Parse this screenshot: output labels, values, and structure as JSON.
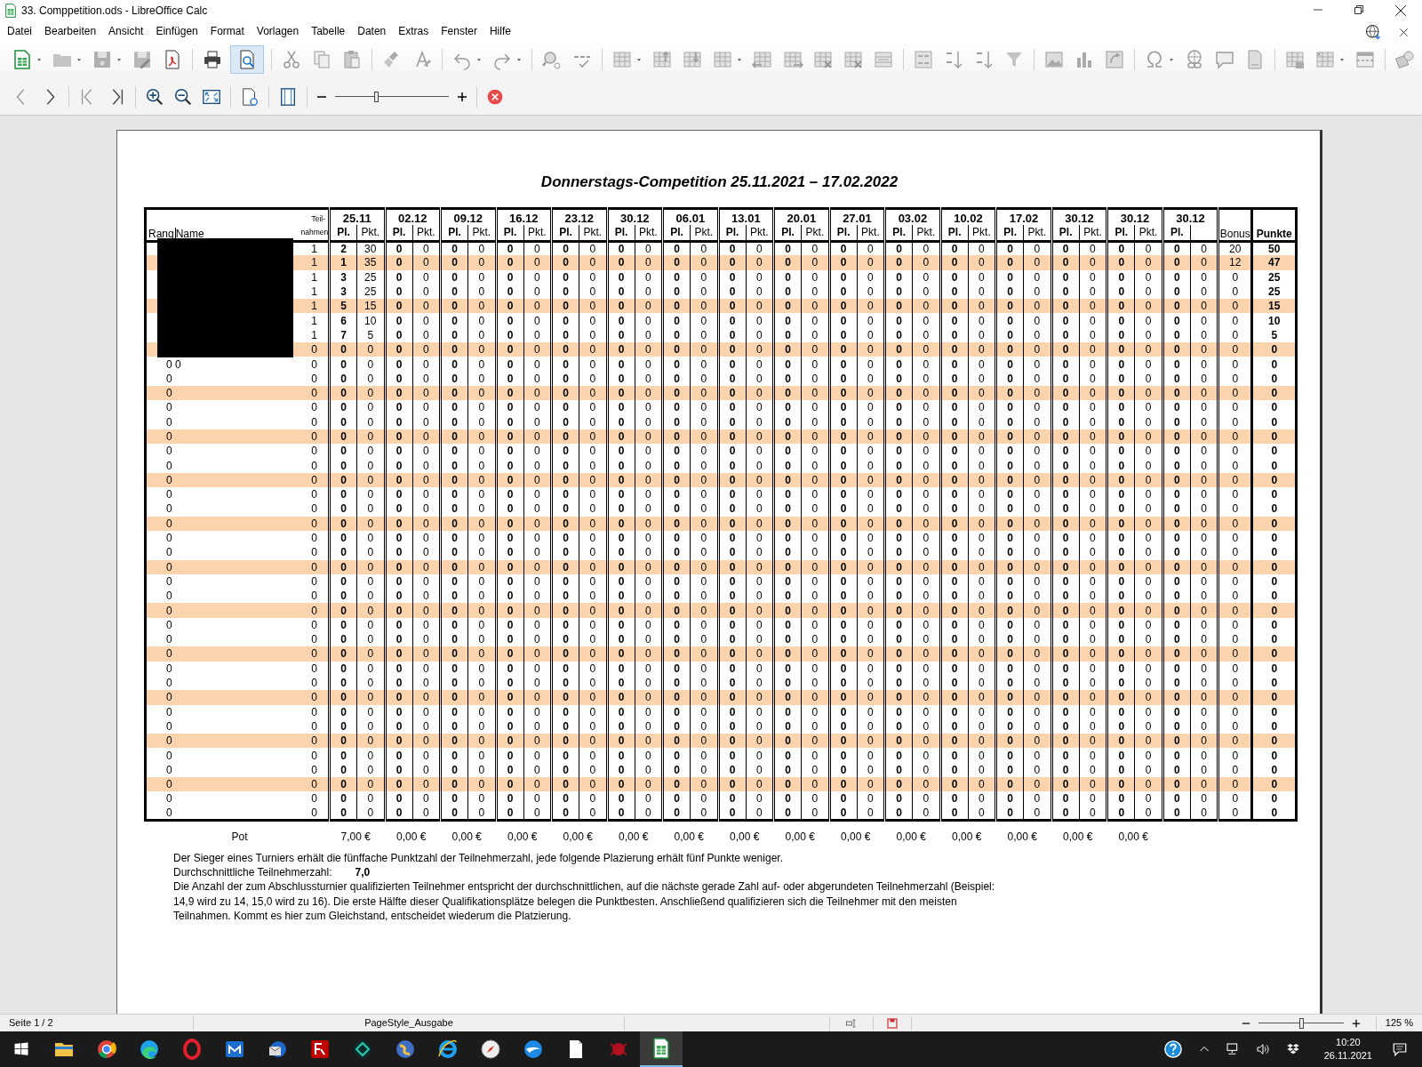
{
  "window": {
    "title": "33. Comppetition.ods - LibreOffice Calc"
  },
  "menu": [
    "Datei",
    "Bearbeiten",
    "Ansicht",
    "Einfügen",
    "Format",
    "Vorlagen",
    "Tabelle",
    "Daten",
    "Extras",
    "Fenster",
    "Hilfe"
  ],
  "toolbar": {
    "print_preview": {
      "selected": true
    }
  },
  "preview_toolbar": {
    "zoom_slider": {
      "level": 0.36
    }
  },
  "document": {
    "title": "Donnerstags-Competition 25.11.2021 – 17.02.2022",
    "header": {
      "rang": "Rang",
      "name": "Name",
      "teilnahmen_top": "Teil-",
      "teilnahmen_bottom": "nahmen",
      "bonus": "Bonus",
      "punkte": "Punkte"
    },
    "tournaments": [
      {
        "date": "25.11",
        "pl": "Pl.",
        "pkt": "Pkt."
      },
      {
        "date": "02.12",
        "pl": "Pl.",
        "pkt": "Pkt."
      },
      {
        "date": "09.12",
        "pl": "Pl.",
        "pkt": "Pkt."
      },
      {
        "date": "16.12",
        "pl": "Pl.",
        "pkt": "Pkt."
      },
      {
        "date": "23.12",
        "pl": "Pl.",
        "pkt": "Pkt."
      },
      {
        "date": "30.12",
        "pl": "Pl.",
        "pkt": "Pkt."
      },
      {
        "date": "06.01",
        "pl": "Pl.",
        "pkt": "Pkt."
      },
      {
        "date": "13.01",
        "pl": "Pl.",
        "pkt": "Pkt."
      },
      {
        "date": "20.01",
        "pl": "Pl.",
        "pkt": "Pkt."
      },
      {
        "date": "27.01",
        "pl": "Pl.",
        "pkt": "Pkt."
      },
      {
        "date": "03.02",
        "pl": "Pl.",
        "pkt": "Pkt."
      },
      {
        "date": "10.02",
        "pl": "Pl.",
        "pkt": "Pkt."
      },
      {
        "date": "17.02",
        "pl": "Pl.",
        "pkt": "Pkt."
      },
      {
        "date": "30.12",
        "pl": "Pl.",
        "pkt": "Pkt."
      },
      {
        "date": "30.12",
        "pl": "Pl.",
        "pkt": "Pkt."
      },
      {
        "date": "30.12",
        "pl": "Pl."
      }
    ],
    "rows": [
      {
        "redacted": true,
        "teilnahmen": "1",
        "results": [
          "2",
          "30",
          "0",
          "0",
          "0",
          "0",
          "0",
          "0",
          "0",
          "0",
          "0",
          "0",
          "0",
          "0",
          "0",
          "0",
          "0",
          "0",
          "0",
          "0",
          "0",
          "0",
          "0",
          "0",
          "0",
          "0",
          "0",
          "0",
          "0",
          "0",
          "0",
          "0"
        ],
        "bonus": "20",
        "punkte": "50",
        "shaded": false
      },
      {
        "redacted": true,
        "teilnahmen": "1",
        "results": [
          "1",
          "35",
          "0",
          "0",
          "0",
          "0",
          "0",
          "0",
          "0",
          "0",
          "0",
          "0",
          "0",
          "0",
          "0",
          "0",
          "0",
          "0",
          "0",
          "0",
          "0",
          "0",
          "0",
          "0",
          "0",
          "0",
          "0",
          "0",
          "0",
          "0",
          "0",
          "0"
        ],
        "bonus": "12",
        "punkte": "47",
        "shaded": true
      },
      {
        "redacted": true,
        "teilnahmen": "1",
        "results": [
          "3",
          "25",
          "0",
          "0",
          "0",
          "0",
          "0",
          "0",
          "0",
          "0",
          "0",
          "0",
          "0",
          "0",
          "0",
          "0",
          "0",
          "0",
          "0",
          "0",
          "0",
          "0",
          "0",
          "0",
          "0",
          "0",
          "0",
          "0",
          "0",
          "0",
          "0",
          "0"
        ],
        "bonus": "0",
        "punkte": "25",
        "shaded": false
      },
      {
        "redacted": true,
        "teilnahmen": "1",
        "results": [
          "3",
          "25",
          "0",
          "0",
          "0",
          "0",
          "0",
          "0",
          "0",
          "0",
          "0",
          "0",
          "0",
          "0",
          "0",
          "0",
          "0",
          "0",
          "0",
          "0",
          "0",
          "0",
          "0",
          "0",
          "0",
          "0",
          "0",
          "0",
          "0",
          "0",
          "0",
          "0"
        ],
        "bonus": "0",
        "punkte": "25",
        "shaded": false
      },
      {
        "redacted": true,
        "teilnahmen": "1",
        "results": [
          "5",
          "15",
          "0",
          "0",
          "0",
          "0",
          "0",
          "0",
          "0",
          "0",
          "0",
          "0",
          "0",
          "0",
          "0",
          "0",
          "0",
          "0",
          "0",
          "0",
          "0",
          "0",
          "0",
          "0",
          "0",
          "0",
          "0",
          "0",
          "0",
          "0",
          "0",
          "0"
        ],
        "bonus": "0",
        "punkte": "15",
        "shaded": true
      },
      {
        "redacted": true,
        "teilnahmen": "1",
        "results": [
          "6",
          "10",
          "0",
          "0",
          "0",
          "0",
          "0",
          "0",
          "0",
          "0",
          "0",
          "0",
          "0",
          "0",
          "0",
          "0",
          "0",
          "0",
          "0",
          "0",
          "0",
          "0",
          "0",
          "0",
          "0",
          "0",
          "0",
          "0",
          "0",
          "0",
          "0",
          "0"
        ],
        "bonus": "0",
        "punkte": "10",
        "shaded": false
      },
      {
        "redacted": true,
        "teilnahmen": "1",
        "results": [
          "7",
          "5",
          "0",
          "0",
          "0",
          "0",
          "0",
          "0",
          "0",
          "0",
          "0",
          "0",
          "0",
          "0",
          "0",
          "0",
          "0",
          "0",
          "0",
          "0",
          "0",
          "0",
          "0",
          "0",
          "0",
          "0",
          "0",
          "0",
          "0",
          "0",
          "0",
          "0"
        ],
        "bonus": "0",
        "punkte": "5",
        "shaded": false
      },
      {
        "redacted": true,
        "teilnahmen": "0",
        "results": [
          "0",
          "0",
          "0",
          "0",
          "0",
          "0",
          "0",
          "0",
          "0",
          "0",
          "0",
          "0",
          "0",
          "0",
          "0",
          "0",
          "0",
          "0",
          "0",
          "0",
          "0",
          "0",
          "0",
          "0",
          "0",
          "0",
          "0",
          "0",
          "0",
          "0",
          "0",
          "0"
        ],
        "bonus": "0",
        "punkte": "0",
        "shaded": true
      },
      {
        "rang": "0",
        "name": "0",
        "teilnahmen": "0",
        "results": [
          "0",
          "0",
          "0",
          "0",
          "0",
          "0",
          "0",
          "0",
          "0",
          "0",
          "0",
          "0",
          "0",
          "0",
          "0",
          "0",
          "0",
          "0",
          "0",
          "0",
          "0",
          "0",
          "0",
          "0",
          "0",
          "0",
          "0",
          "0",
          "0",
          "0",
          "0",
          "0"
        ],
        "bonus": "0",
        "punkte": "0",
        "shaded": false
      },
      {
        "rang": "0",
        "teilnahmen": "0",
        "results": [
          "0",
          "0",
          "0",
          "0",
          "0",
          "0",
          "0",
          "0",
          "0",
          "0",
          "0",
          "0",
          "0",
          "0",
          "0",
          "0",
          "0",
          "0",
          "0",
          "0",
          "0",
          "0",
          "0",
          "0",
          "0",
          "0",
          "0",
          "0",
          "0",
          "0",
          "0",
          "0"
        ],
        "bonus": "0",
        "punkte": "0",
        "shaded": false
      },
      {
        "rang": "0",
        "teilnahmen": "0",
        "results": [
          "0",
          "0",
          "0",
          "0",
          "0",
          "0",
          "0",
          "0",
          "0",
          "0",
          "0",
          "0",
          "0",
          "0",
          "0",
          "0",
          "0",
          "0",
          "0",
          "0",
          "0",
          "0",
          "0",
          "0",
          "0",
          "0",
          "0",
          "0",
          "0",
          "0",
          "0",
          "0"
        ],
        "bonus": "0",
        "punkte": "0",
        "shaded": true
      },
      {
        "rang": "0",
        "teilnahmen": "0",
        "results": [
          "0",
          "0",
          "0",
          "0",
          "0",
          "0",
          "0",
          "0",
          "0",
          "0",
          "0",
          "0",
          "0",
          "0",
          "0",
          "0",
          "0",
          "0",
          "0",
          "0",
          "0",
          "0",
          "0",
          "0",
          "0",
          "0",
          "0",
          "0",
          "0",
          "0",
          "0",
          "0"
        ],
        "bonus": "0",
        "punkte": "0",
        "shaded": false
      },
      {
        "rang": "0",
        "teilnahmen": "0",
        "results": [
          "0",
          "0",
          "0",
          "0",
          "0",
          "0",
          "0",
          "0",
          "0",
          "0",
          "0",
          "0",
          "0",
          "0",
          "0",
          "0",
          "0",
          "0",
          "0",
          "0",
          "0",
          "0",
          "0",
          "0",
          "0",
          "0",
          "0",
          "0",
          "0",
          "0",
          "0",
          "0"
        ],
        "bonus": "0",
        "punkte": "0",
        "shaded": false
      },
      {
        "rang": "0",
        "teilnahmen": "0",
        "results": [
          "0",
          "0",
          "0",
          "0",
          "0",
          "0",
          "0",
          "0",
          "0",
          "0",
          "0",
          "0",
          "0",
          "0",
          "0",
          "0",
          "0",
          "0",
          "0",
          "0",
          "0",
          "0",
          "0",
          "0",
          "0",
          "0",
          "0",
          "0",
          "0",
          "0",
          "0",
          "0"
        ],
        "bonus": "0",
        "punkte": "0",
        "shaded": true
      },
      {
        "rang": "0",
        "teilnahmen": "0",
        "results": [
          "0",
          "0",
          "0",
          "0",
          "0",
          "0",
          "0",
          "0",
          "0",
          "0",
          "0",
          "0",
          "0",
          "0",
          "0",
          "0",
          "0",
          "0",
          "0",
          "0",
          "0",
          "0",
          "0",
          "0",
          "0",
          "0",
          "0",
          "0",
          "0",
          "0",
          "0",
          "0"
        ],
        "bonus": "0",
        "punkte": "0",
        "shaded": false
      },
      {
        "rang": "0",
        "teilnahmen": "0",
        "results": [
          "0",
          "0",
          "0",
          "0",
          "0",
          "0",
          "0",
          "0",
          "0",
          "0",
          "0",
          "0",
          "0",
          "0",
          "0",
          "0",
          "0",
          "0",
          "0",
          "0",
          "0",
          "0",
          "0",
          "0",
          "0",
          "0",
          "0",
          "0",
          "0",
          "0",
          "0",
          "0"
        ],
        "bonus": "0",
        "punkte": "0",
        "shaded": false
      },
      {
        "rang": "0",
        "teilnahmen": "0",
        "results": [
          "0",
          "0",
          "0",
          "0",
          "0",
          "0",
          "0",
          "0",
          "0",
          "0",
          "0",
          "0",
          "0",
          "0",
          "0",
          "0",
          "0",
          "0",
          "0",
          "0",
          "0",
          "0",
          "0",
          "0",
          "0",
          "0",
          "0",
          "0",
          "0",
          "0",
          "0",
          "0"
        ],
        "bonus": "0",
        "punkte": "0",
        "shaded": true
      },
      {
        "rang": "0",
        "teilnahmen": "0",
        "results": [
          "0",
          "0",
          "0",
          "0",
          "0",
          "0",
          "0",
          "0",
          "0",
          "0",
          "0",
          "0",
          "0",
          "0",
          "0",
          "0",
          "0",
          "0",
          "0",
          "0",
          "0",
          "0",
          "0",
          "0",
          "0",
          "0",
          "0",
          "0",
          "0",
          "0",
          "0",
          "0"
        ],
        "bonus": "0",
        "punkte": "0",
        "shaded": false
      },
      {
        "rang": "0",
        "teilnahmen": "0",
        "results": [
          "0",
          "0",
          "0",
          "0",
          "0",
          "0",
          "0",
          "0",
          "0",
          "0",
          "0",
          "0",
          "0",
          "0",
          "0",
          "0",
          "0",
          "0",
          "0",
          "0",
          "0",
          "0",
          "0",
          "0",
          "0",
          "0",
          "0",
          "0",
          "0",
          "0",
          "0",
          "0"
        ],
        "bonus": "0",
        "punkte": "0",
        "shaded": false
      },
      {
        "rang": "0",
        "teilnahmen": "0",
        "results": [
          "0",
          "0",
          "0",
          "0",
          "0",
          "0",
          "0",
          "0",
          "0",
          "0",
          "0",
          "0",
          "0",
          "0",
          "0",
          "0",
          "0",
          "0",
          "0",
          "0",
          "0",
          "0",
          "0",
          "0",
          "0",
          "0",
          "0",
          "0",
          "0",
          "0",
          "0",
          "0"
        ],
        "bonus": "0",
        "punkte": "0",
        "shaded": true
      },
      {
        "rang": "0",
        "teilnahmen": "0",
        "results": [
          "0",
          "0",
          "0",
          "0",
          "0",
          "0",
          "0",
          "0",
          "0",
          "0",
          "0",
          "0",
          "0",
          "0",
          "0",
          "0",
          "0",
          "0",
          "0",
          "0",
          "0",
          "0",
          "0",
          "0",
          "0",
          "0",
          "0",
          "0",
          "0",
          "0",
          "0",
          "0"
        ],
        "bonus": "0",
        "punkte": "0",
        "shaded": false
      },
      {
        "rang": "0",
        "teilnahmen": "0",
        "results": [
          "0",
          "0",
          "0",
          "0",
          "0",
          "0",
          "0",
          "0",
          "0",
          "0",
          "0",
          "0",
          "0",
          "0",
          "0",
          "0",
          "0",
          "0",
          "0",
          "0",
          "0",
          "0",
          "0",
          "0",
          "0",
          "0",
          "0",
          "0",
          "0",
          "0",
          "0",
          "0"
        ],
        "bonus": "0",
        "punkte": "0",
        "shaded": false
      },
      {
        "rang": "0",
        "teilnahmen": "0",
        "results": [
          "0",
          "0",
          "0",
          "0",
          "0",
          "0",
          "0",
          "0",
          "0",
          "0",
          "0",
          "0",
          "0",
          "0",
          "0",
          "0",
          "0",
          "0",
          "0",
          "0",
          "0",
          "0",
          "0",
          "0",
          "0",
          "0",
          "0",
          "0",
          "0",
          "0",
          "0",
          "0"
        ],
        "bonus": "0",
        "punkte": "0",
        "shaded": true
      },
      {
        "rang": "0",
        "teilnahmen": "0",
        "results": [
          "0",
          "0",
          "0",
          "0",
          "0",
          "0",
          "0",
          "0",
          "0",
          "0",
          "0",
          "0",
          "0",
          "0",
          "0",
          "0",
          "0",
          "0",
          "0",
          "0",
          "0",
          "0",
          "0",
          "0",
          "0",
          "0",
          "0",
          "0",
          "0",
          "0",
          "0",
          "0"
        ],
        "bonus": "0",
        "punkte": "0",
        "shaded": false
      },
      {
        "rang": "0",
        "teilnahmen": "0",
        "results": [
          "0",
          "0",
          "0",
          "0",
          "0",
          "0",
          "0",
          "0",
          "0",
          "0",
          "0",
          "0",
          "0",
          "0",
          "0",
          "0",
          "0",
          "0",
          "0",
          "0",
          "0",
          "0",
          "0",
          "0",
          "0",
          "0",
          "0",
          "0",
          "0",
          "0",
          "0",
          "0"
        ],
        "bonus": "0",
        "punkte": "0",
        "shaded": false
      },
      {
        "rang": "0",
        "teilnahmen": "0",
        "results": [
          "0",
          "0",
          "0",
          "0",
          "0",
          "0",
          "0",
          "0",
          "0",
          "0",
          "0",
          "0",
          "0",
          "0",
          "0",
          "0",
          "0",
          "0",
          "0",
          "0",
          "0",
          "0",
          "0",
          "0",
          "0",
          "0",
          "0",
          "0",
          "0",
          "0",
          "0",
          "0"
        ],
        "bonus": "0",
        "punkte": "0",
        "shaded": true
      },
      {
        "rang": "0",
        "teilnahmen": "0",
        "results": [
          "0",
          "0",
          "0",
          "0",
          "0",
          "0",
          "0",
          "0",
          "0",
          "0",
          "0",
          "0",
          "0",
          "0",
          "0",
          "0",
          "0",
          "0",
          "0",
          "0",
          "0",
          "0",
          "0",
          "0",
          "0",
          "0",
          "0",
          "0",
          "0",
          "0",
          "0",
          "0"
        ],
        "bonus": "0",
        "punkte": "0",
        "shaded": false
      },
      {
        "rang": "0",
        "teilnahmen": "0",
        "results": [
          "0",
          "0",
          "0",
          "0",
          "0",
          "0",
          "0",
          "0",
          "0",
          "0",
          "0",
          "0",
          "0",
          "0",
          "0",
          "0",
          "0",
          "0",
          "0",
          "0",
          "0",
          "0",
          "0",
          "0",
          "0",
          "0",
          "0",
          "0",
          "0",
          "0",
          "0",
          "0"
        ],
        "bonus": "0",
        "punkte": "0",
        "shaded": false
      },
      {
        "rang": "0",
        "teilnahmen": "0",
        "results": [
          "0",
          "0",
          "0",
          "0",
          "0",
          "0",
          "0",
          "0",
          "0",
          "0",
          "0",
          "0",
          "0",
          "0",
          "0",
          "0",
          "0",
          "0",
          "0",
          "0",
          "0",
          "0",
          "0",
          "0",
          "0",
          "0",
          "0",
          "0",
          "0",
          "0",
          "0",
          "0"
        ],
        "bonus": "0",
        "punkte": "0",
        "shaded": true
      },
      {
        "rang": "0",
        "teilnahmen": "0",
        "results": [
          "0",
          "0",
          "0",
          "0",
          "0",
          "0",
          "0",
          "0",
          "0",
          "0",
          "0",
          "0",
          "0",
          "0",
          "0",
          "0",
          "0",
          "0",
          "0",
          "0",
          "0",
          "0",
          "0",
          "0",
          "0",
          "0",
          "0",
          "0",
          "0",
          "0",
          "0",
          "0"
        ],
        "bonus": "0",
        "punkte": "0",
        "shaded": false
      },
      {
        "rang": "0",
        "teilnahmen": "0",
        "results": [
          "0",
          "0",
          "0",
          "0",
          "0",
          "0",
          "0",
          "0",
          "0",
          "0",
          "0",
          "0",
          "0",
          "0",
          "0",
          "0",
          "0",
          "0",
          "0",
          "0",
          "0",
          "0",
          "0",
          "0",
          "0",
          "0",
          "0",
          "0",
          "0",
          "0",
          "0",
          "0"
        ],
        "bonus": "0",
        "punkte": "0",
        "shaded": false
      },
      {
        "rang": "0",
        "teilnahmen": "0",
        "results": [
          "0",
          "0",
          "0",
          "0",
          "0",
          "0",
          "0",
          "0",
          "0",
          "0",
          "0",
          "0",
          "0",
          "0",
          "0",
          "0",
          "0",
          "0",
          "0",
          "0",
          "0",
          "0",
          "0",
          "0",
          "0",
          "0",
          "0",
          "0",
          "0",
          "0",
          "0",
          "0"
        ],
        "bonus": "0",
        "punkte": "0",
        "shaded": true
      },
      {
        "rang": "0",
        "teilnahmen": "0",
        "results": [
          "0",
          "0",
          "0",
          "0",
          "0",
          "0",
          "0",
          "0",
          "0",
          "0",
          "0",
          "0",
          "0",
          "0",
          "0",
          "0",
          "0",
          "0",
          "0",
          "0",
          "0",
          "0",
          "0",
          "0",
          "0",
          "0",
          "0",
          "0",
          "0",
          "0",
          "0",
          "0"
        ],
        "bonus": "0",
        "punkte": "0",
        "shaded": false
      },
      {
        "rang": "0",
        "teilnahmen": "0",
        "results": [
          "0",
          "0",
          "0",
          "0",
          "0",
          "0",
          "0",
          "0",
          "0",
          "0",
          "0",
          "0",
          "0",
          "0",
          "0",
          "0",
          "0",
          "0",
          "0",
          "0",
          "0",
          "0",
          "0",
          "0",
          "0",
          "0",
          "0",
          "0",
          "0",
          "0",
          "0",
          "0"
        ],
        "bonus": "0",
        "punkte": "0",
        "shaded": false
      },
      {
        "rang": "0",
        "teilnahmen": "0",
        "results": [
          "0",
          "0",
          "0",
          "0",
          "0",
          "0",
          "0",
          "0",
          "0",
          "0",
          "0",
          "0",
          "0",
          "0",
          "0",
          "0",
          "0",
          "0",
          "0",
          "0",
          "0",
          "0",
          "0",
          "0",
          "0",
          "0",
          "0",
          "0",
          "0",
          "0",
          "0",
          "0"
        ],
        "bonus": "0",
        "punkte": "0",
        "shaded": true
      },
      {
        "rang": "0",
        "teilnahmen": "0",
        "results": [
          "0",
          "0",
          "0",
          "0",
          "0",
          "0",
          "0",
          "0",
          "0",
          "0",
          "0",
          "0",
          "0",
          "0",
          "0",
          "0",
          "0",
          "0",
          "0",
          "0",
          "0",
          "0",
          "0",
          "0",
          "0",
          "0",
          "0",
          "0",
          "0",
          "0",
          "0",
          "0"
        ],
        "bonus": "0",
        "punkte": "0",
        "shaded": false
      },
      {
        "rang": "0",
        "teilnahmen": "0",
        "results": [
          "0",
          "0",
          "0",
          "0",
          "0",
          "0",
          "0",
          "0",
          "0",
          "0",
          "0",
          "0",
          "0",
          "0",
          "0",
          "0",
          "0",
          "0",
          "0",
          "0",
          "0",
          "0",
          "0",
          "0",
          "0",
          "0",
          "0",
          "0",
          "0",
          "0",
          "0",
          "0"
        ],
        "bonus": "0",
        "punkte": "0",
        "shaded": false
      },
      {
        "rang": "0",
        "teilnahmen": "0",
        "results": [
          "0",
          "0",
          "0",
          "0",
          "0",
          "0",
          "0",
          "0",
          "0",
          "0",
          "0",
          "0",
          "0",
          "0",
          "0",
          "0",
          "0",
          "0",
          "0",
          "0",
          "0",
          "0",
          "0",
          "0",
          "0",
          "0",
          "0",
          "0",
          "0",
          "0",
          "0",
          "0"
        ],
        "bonus": "0",
        "punkte": "0",
        "shaded": true
      },
      {
        "rang": "0",
        "teilnahmen": "0",
        "results": [
          "0",
          "0",
          "0",
          "0",
          "0",
          "0",
          "0",
          "0",
          "0",
          "0",
          "0",
          "0",
          "0",
          "0",
          "0",
          "0",
          "0",
          "0",
          "0",
          "0",
          "0",
          "0",
          "0",
          "0",
          "0",
          "0",
          "0",
          "0",
          "0",
          "0",
          "0",
          "0"
        ],
        "bonus": "0",
        "punkte": "0",
        "shaded": false
      },
      {
        "rang": "0",
        "teilnahmen": "0",
        "results": [
          "0",
          "0",
          "0",
          "0",
          "0",
          "0",
          "0",
          "0",
          "0",
          "0",
          "0",
          "0",
          "0",
          "0",
          "0",
          "0",
          "0",
          "0",
          "0",
          "0",
          "0",
          "0",
          "0",
          "0",
          "0",
          "0",
          "0",
          "0",
          "0",
          "0",
          "0",
          "0"
        ],
        "bonus": "0",
        "punkte": "0",
        "shaded": false
      }
    ],
    "pot": {
      "label": "Pot",
      "values": [
        "7,00 €",
        "0,00 €",
        "0,00 €",
        "0,00 €",
        "0,00 €",
        "0,00 €",
        "0,00 €",
        "0,00 €",
        "0,00 €",
        "0,00 €",
        "0,00 €",
        "0,00 €",
        "0,00 €",
        "0,00 €",
        "0,00 €"
      ]
    },
    "notes": {
      "rule": "Der Sieger eines Turniers erhält die fünffache Punktzahl der Teilnehmerzahl, jede folgende Plazierung erhält fünf Punkte weniger.",
      "average_label": "Durchschnittliche Teilnehmerzahl:",
      "average_value": "7,0",
      "qualification": "Die Anzahl der zum Abschlussturnier qualifizierten Teilnehmer entspricht der durchschnittlichen, auf die nächste gerade Zahl auf- oder abgerundeten Teilnehmerzahl (Beispiel: 14,9 wird zu 14, 15,0 wird zu 16). Die erste Hälfte dieser Qualifikationsplätze belegen die Punktbesten. Anschließend qualifizieren sich die Teilnehmer mit den meisten Teilnahmen. Kommt es hier zum Gleichstand, entscheidet wiederum die Platzierung."
    }
  },
  "status_bar": {
    "page": "Seite 1 / 2",
    "page_style": "PageStyle_Ausgabe",
    "zoom_slider": {
      "level": 0.5
    },
    "zoom": "125 %"
  },
  "taskbar": {
    "time": "10:20",
    "date": "26.11.2021"
  }
}
